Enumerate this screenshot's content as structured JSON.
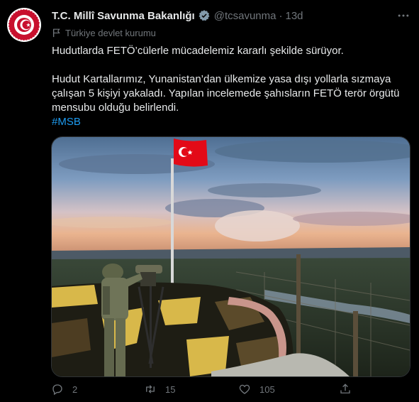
{
  "account": {
    "name": "T.C. Millî Savunma Bakanlığı",
    "handle": "@tcsavunma",
    "separator": "·",
    "time": "13d",
    "label": "Türkiye devlet kurumu"
  },
  "tweet": {
    "line1": "Hudutlarda FETÖ’cülerle mücadelemiz kararlı şekilde sürüyor.",
    "line2": "Hudut Kartallarımız, Yunanistan’dan ülkemize yasa dışı yollarla sızmaya çalışan 5 kişiyi yakaladı. Yapılan incelemede şahısların FETÖ terör örgütü mensubu olduğu belirlendi.",
    "hashtag": "#MSB"
  },
  "actions": {
    "replies": "2",
    "retweets": "15",
    "likes": "105"
  },
  "colors": {
    "background": "#000000",
    "text": "#e7e9ea",
    "muted": "#71767b",
    "accent": "#1d9bf0",
    "flag_red": "#e30a17"
  },
  "icons": [
    "verified-badge-icon",
    "more-icon",
    "flag-icon",
    "reply-icon",
    "retweet-icon",
    "like-icon",
    "share-icon"
  ]
}
